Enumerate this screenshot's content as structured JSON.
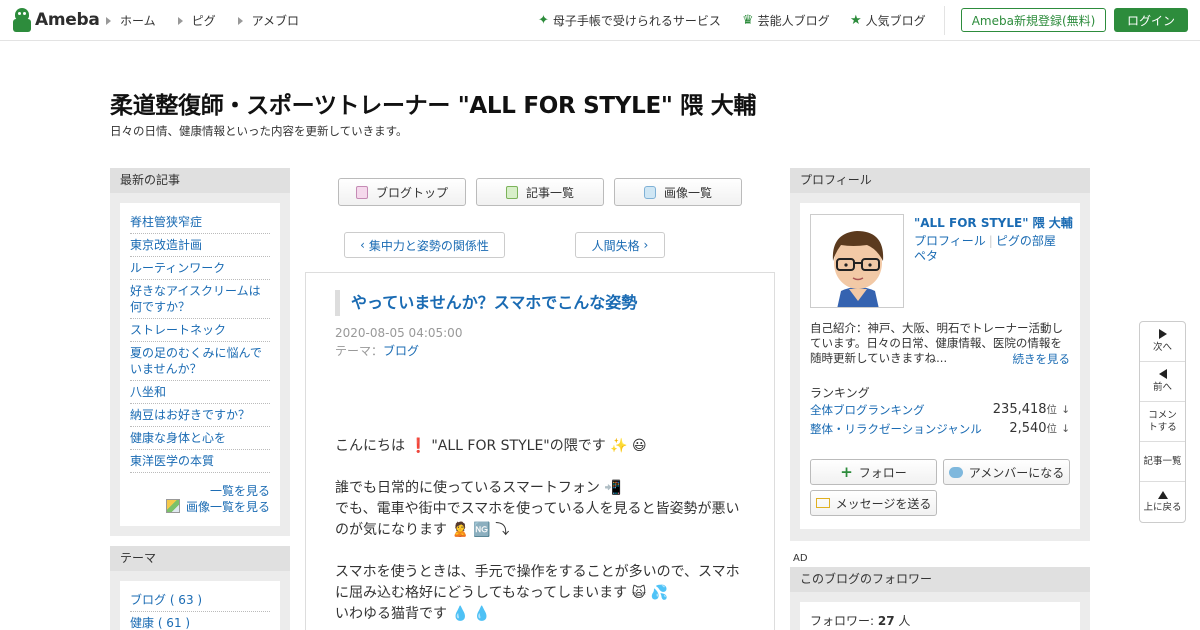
{
  "header": {
    "logo_text": "Ameba",
    "nav": [
      "ホーム",
      "ピグ",
      "アメブロ"
    ],
    "links": [
      {
        "icon": "sparkle-icon",
        "label": "母子手帳で受けられるサービス"
      },
      {
        "icon": "crown-icon",
        "label": "芸能人ブログ"
      },
      {
        "icon": "star-icon",
        "label": "人気ブログ"
      }
    ],
    "register_label": "Ameba新規登録(無料)",
    "login_label": "ログイン"
  },
  "blog": {
    "title": "柔道整復師・スポーツトレーナー \"ALL FOR STYLE\" 隈 大輔",
    "description": "日々の日情、健康情報といった内容を更新していきます。"
  },
  "left": {
    "recent_header": "最新の記事",
    "recent": [
      "脊柱管狭窄症",
      "東京改造計画",
      "ルーティンワーク",
      "好きなアイスクリームは何ですか？",
      "ストレートネック",
      "夏の足のむくみに悩んでいませんか？",
      "八坐和",
      "納豆はお好きですか？",
      "健康な身体と心を",
      "東洋医学の本質"
    ],
    "see_all": "一覧を見る",
    "see_images": "画像一覧を見る",
    "theme_header": "テーマ",
    "themes": [
      "ブログ ( 63 )",
      "健康 ( 61 )"
    ]
  },
  "center": {
    "toolbar": {
      "blog_top": "ブログトップ",
      "article_list": "記事一覧",
      "image_list": "画像一覧"
    },
    "prev_post": "集中力と姿勢の関係性",
    "next_post": "人間失格",
    "article": {
      "title": "やっていませんか？スマホでこんな姿勢",
      "date": "2020-08-05 04:05:00",
      "theme_label": "テーマ：",
      "theme_value": "ブログ",
      "body": [
        "こんにちは ❗ \"ALL FOR STYLE\"の隈です ✨ 😃",
        "",
        "誰でも日常的に使っているスマートフォン 📲",
        "でも、電車や街中でスマホを使っている人を見ると皆姿勢が悪いのが気になります 🙎 🆖 ⤵",
        "",
        "スマホを使うときは、手元で操作をすることが多いので、スマホに屈み込む格好にどうしてもなってしまいます 🙀 💦",
        "いわゆる猫背です 💧 💧"
      ]
    }
  },
  "right": {
    "profile_header": "プロフィール",
    "name": "\"ALL FOR STYLE\" 隈 大輔",
    "links": [
      "プロフィール",
      "ピグの部屋",
      "ペタ"
    ],
    "intro": "自己紹介：神戸、大阪、明石でトレーナー活動しています。日々の日常、健康情報、医院の情報を随時更新していきますね...",
    "more": "続きを見る",
    "ranking_header": "ランキング",
    "rankings": [
      {
        "label": "全体ブログランキング",
        "value": "235,418",
        "unit": "位",
        "arrow": "↓"
      },
      {
        "label": "整体・リラクゼーションジャンル",
        "value": "2,540",
        "unit": "位",
        "arrow": "↓"
      }
    ],
    "follow_label": "フォロー",
    "amember_label": "アメンバーになる",
    "message_label": "メッセージを送る",
    "ad_label": "AD",
    "followers_header": "このブログのフォロワー",
    "followers_label": "フォロワー:",
    "followers_count": "27",
    "followers_unit": "人"
  },
  "float_nav": {
    "next": "次へ",
    "prev": "前へ",
    "comment": "コメントする",
    "article_list": "記事一覧",
    "top": "上に戻る"
  },
  "colors": {
    "brand": "#2d8c3c",
    "link": "#1a6bb3"
  }
}
